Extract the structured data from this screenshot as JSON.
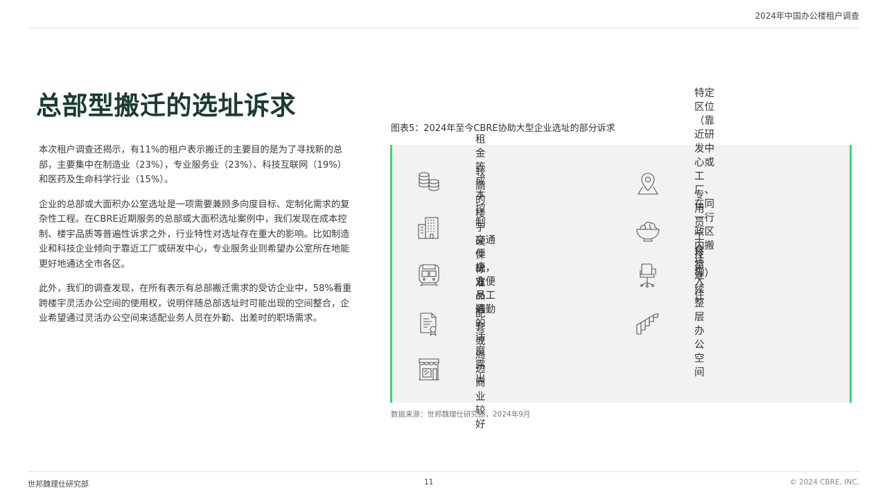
{
  "header": {
    "report_title": "2024年中国办公楼租户调查"
  },
  "main": {
    "title": "总部型搬迁的选址诉求",
    "paragraphs": [
      "本次租户调查还揭示，有11%的租户表示搬迁的主要目的是为了寻找新的总部，主要集中在制造业（23%），专业服务业（23%）、科技互联网（19%）和医药及生命科学行业（15%）。",
      "企业的总部或大面积办公室选址是一项需要兼顾多向度目标、定制化需求的复杂性工程。在CBRE近期服务的总部或大面积选址案例中，我们发现在成本控制、楼宇品质等普遍性诉求之外，行业特性对选址存在重大的影响。比如制造业和科技企业倾向于靠近工厂或研发中心，专业服务业则希望办公室所在地能更好地通达全市各区。",
      "此外，我们的调查发现，在所有表示有总部搬迁需求的受访企业中，58%看重跨楼宇灵活办公空间的使用权，说明伴随总部选址时可能出现的空间整合，企业希望通过灵活办公空间来适配业务人员在外勤、出差时的职场需求。"
    ]
  },
  "figure": {
    "caption": "图表5：2024年至今CBRE协助大型企业选址的部分诉求",
    "accent_color": "#3ed17f",
    "panel_color": "#f0f3f2",
    "items": [
      {
        "icon": "coins-stack-icon",
        "label": "租金等成本控制"
      },
      {
        "icon": "location-pin-icon",
        "label": "特定区位（靠近研发中心或工\n厂、在同一行政区内搬迁等）"
      },
      {
        "icon": "office-building-icon",
        "label": "较高的楼宇硬件标准"
      },
      {
        "icon": "salad-bowl-icon",
        "label": "专用员工食堂"
      },
      {
        "icon": "train-icon",
        "label": "交通便捷，方便员工通勤"
      },
      {
        "icon": "office-chair-icon",
        "label": "拎包入住"
      },
      {
        "icon": "certificate-icon",
        "label": "企业品牌的适度露出"
      },
      {
        "icon": "stairs-icon",
        "label": "连续整层办公空间"
      },
      {
        "icon": "storefront-icon",
        "label": "配套或周边商业较好"
      }
    ],
    "source": "数据来源：世邦魏理仕研究部，2024年9月"
  },
  "footer": {
    "left": "世邦魏理仕研究部",
    "page_number": "11",
    "copyright": "© 2024 CBRE, INC."
  }
}
